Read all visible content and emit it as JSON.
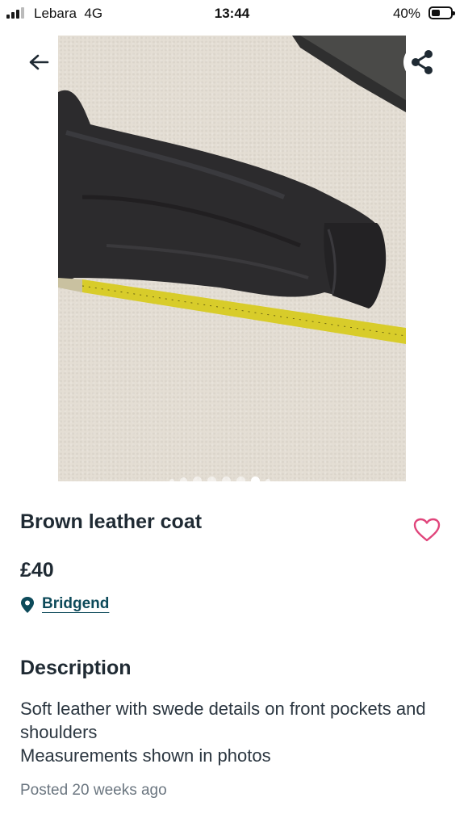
{
  "status_bar": {
    "carrier": "Lebara",
    "network": "4G",
    "time": "13:44",
    "battery": "40%"
  },
  "gallery": {
    "dot_count": 8,
    "active_dot": 6
  },
  "listing": {
    "title": "Brown leather coat",
    "price": "£40",
    "location": "Bridgend"
  },
  "description": {
    "heading": "Description",
    "line1": "Soft leather with swede details on front pockets and shoulders",
    "line2": "Measurements shown in photos"
  },
  "posted": "Posted 20 weeks ago",
  "colors": {
    "accent": "#0d4a5a",
    "favourite": "#e0457b",
    "text": "#1f2a33"
  }
}
